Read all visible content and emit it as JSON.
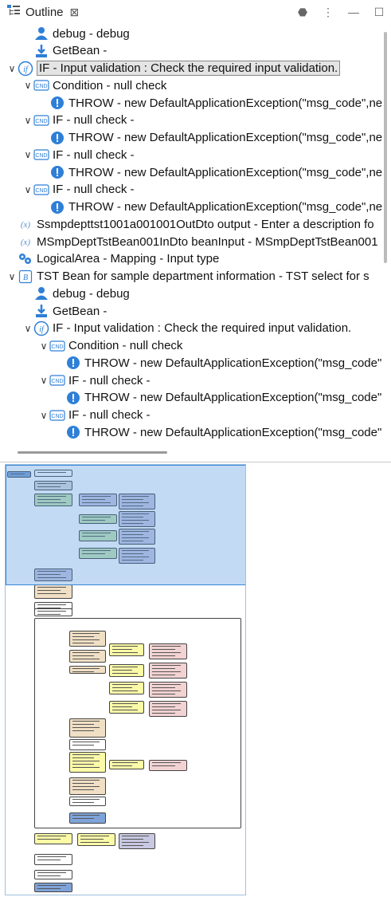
{
  "view": {
    "title": "Outline",
    "close_glyph": "⊠",
    "toolbar": [
      {
        "name": "filter-icon",
        "glyph": "⬣"
      },
      {
        "name": "view-menu-icon",
        "glyph": "⋮"
      },
      {
        "name": "minimize-icon",
        "glyph": "—"
      },
      {
        "name": "maximize-icon",
        "glyph": "☐"
      }
    ]
  },
  "tree": [
    {
      "label": "debug - debug",
      "icon": "user-icon",
      "twisty": ""
    },
    {
      "label": "GetBean -",
      "icon": "download-icon",
      "twisty": ""
    },
    {
      "label": "IF - Input validation : Check the required input validation.",
      "icon": "if-icon",
      "twisty": "∨",
      "selected": true
    },
    {
      "label": "Condition - null check",
      "icon": "condition-icon",
      "twisty": "∨"
    },
    {
      "label": "THROW - new DefaultApplicationException(\"msg_code\",ne",
      "icon": "throw-icon",
      "twisty": ""
    },
    {
      "label": "IF - null check -",
      "icon": "condition-icon",
      "twisty": "∨"
    },
    {
      "label": "THROW - new DefaultApplicationException(\"msg_code\",ne",
      "icon": "throw-icon",
      "twisty": ""
    },
    {
      "label": "IF - null check -",
      "icon": "condition-icon",
      "twisty": "∨"
    },
    {
      "label": "THROW - new DefaultApplicationException(\"msg_code\",ne",
      "icon": "throw-icon",
      "twisty": ""
    },
    {
      "label": "IF - null check -",
      "icon": "condition-icon",
      "twisty": "∨"
    },
    {
      "label": "THROW - new DefaultApplicationException(\"msg_code\",ne",
      "icon": "throw-icon",
      "twisty": ""
    },
    {
      "label": "Ssmpdepttst1001a001001OutDto output - Enter a description fo",
      "icon": "variable-icon",
      "twisty": ""
    },
    {
      "label": "MSmpDeptTstBean001InDto beanInput - MSmpDeptTstBean001",
      "icon": "variable-icon",
      "twisty": ""
    },
    {
      "label": "LogicalArea - Mapping - Input type",
      "icon": "mapping-icon",
      "twisty": ""
    },
    {
      "label": "TST Bean for sample department information - TST select for s",
      "icon": "bean-icon",
      "twisty": "∨"
    },
    {
      "label": "debug - debug",
      "icon": "user-icon",
      "twisty": ""
    },
    {
      "label": "GetBean -",
      "icon": "download-icon",
      "twisty": ""
    },
    {
      "label": "IF - Input validation : Check the required input validation.",
      "icon": "if-icon",
      "twisty": "∨"
    },
    {
      "label": "Condition - null check",
      "icon": "condition-icon",
      "twisty": "∨"
    },
    {
      "label": "THROW - new DefaultApplicationException(\"msg_code\"",
      "icon": "throw-icon",
      "twisty": ""
    },
    {
      "label": "IF - null check -",
      "icon": "condition-icon",
      "twisty": "∨"
    },
    {
      "label": "THROW - new DefaultApplicationException(\"msg_code\"",
      "icon": "throw-icon",
      "twisty": ""
    },
    {
      "label": "IF - null check -",
      "icon": "condition-icon",
      "twisty": "∨"
    },
    {
      "label": "THROW - new DefaultApplicationException(\"msg_code\"",
      "icon": "throw-icon",
      "twisty": ""
    }
  ],
  "colors": {
    "selection_fill": "#e4e4e4",
    "minimap_viewport": "#5096dc",
    "icon_blue": "#2f7fd6"
  }
}
